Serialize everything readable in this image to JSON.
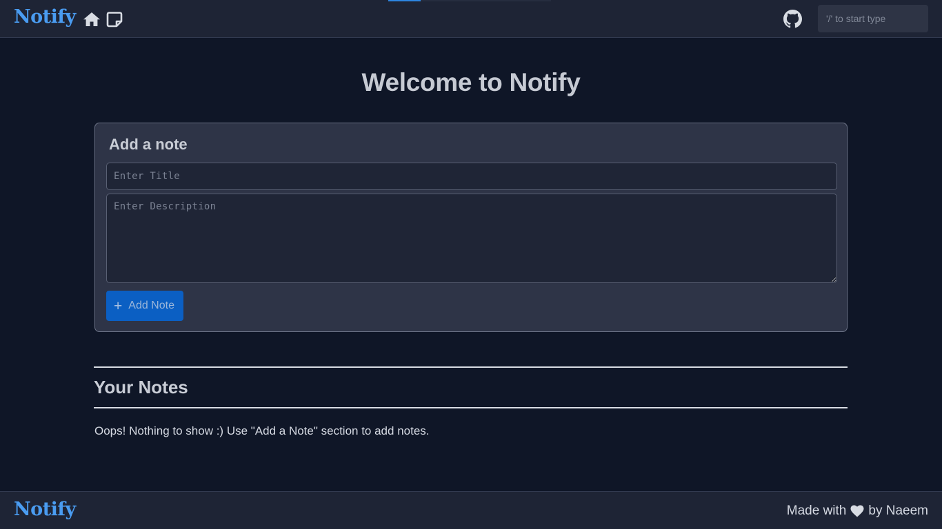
{
  "navbar": {
    "brand": "Notify",
    "loading_progress": 0.2,
    "icons": {
      "home": "home-icon",
      "notes": "sticky-note-icon",
      "github": "github-icon"
    },
    "search_placeholder": "'/' to start type"
  },
  "main": {
    "heading": "Welcome to Notify",
    "add_card": {
      "title": "Add a note",
      "title_placeholder": "Enter Title",
      "title_value": "",
      "description_placeholder": "Enter Description",
      "description_value": "",
      "button_label": "Add Note",
      "button_icon": "plus-icon"
    },
    "notes": {
      "heading": "Your Notes",
      "empty_message": "Oops! Nothing to show :) Use \"Add a Note\" section to add notes."
    }
  },
  "footer": {
    "brand": "Notify",
    "made_with": "Made with",
    "by": "by Naeem",
    "icon": "heart-icon"
  },
  "colors": {
    "background": "#0f1627",
    "navbar": "#1e2435",
    "brand": "#4a9cf1",
    "card": "#2e3447",
    "button": "#0b5fc3"
  }
}
